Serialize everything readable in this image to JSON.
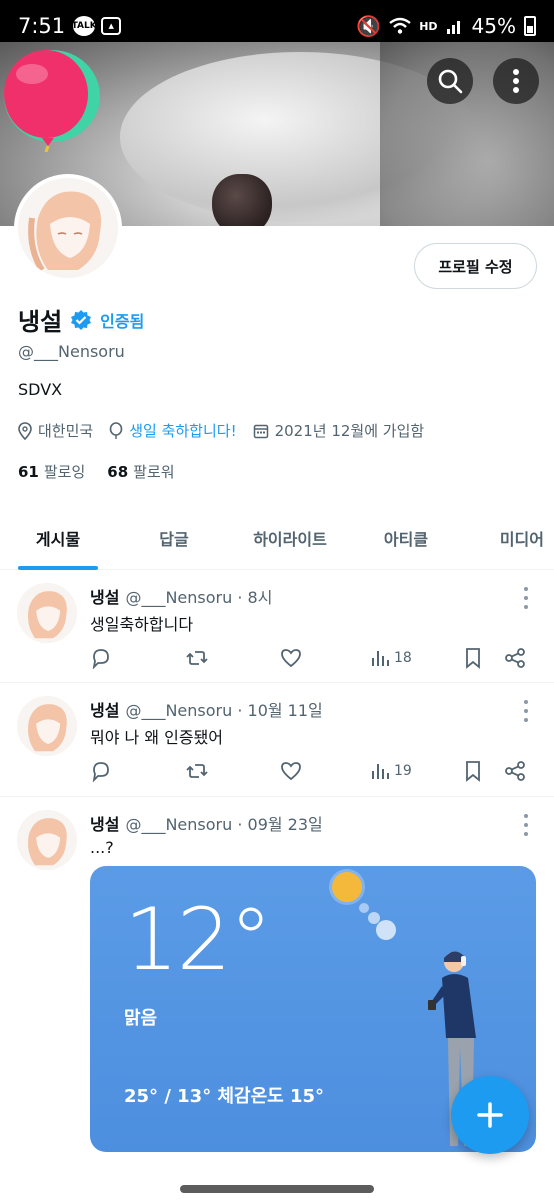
{
  "status_bar": {
    "time": "7:51",
    "talk_label": "TALK",
    "hd_label": "HD",
    "battery": "45%"
  },
  "profile": {
    "display_name": "냉설",
    "verified_label": "인증됨",
    "handle": "@___Nensoru",
    "bio": "SDVX",
    "location": "대한민국",
    "birthday_text": "생일 축하합니다!",
    "joined": "2021년 12월에 가입함",
    "following_count": "61",
    "following_label": "팔로잉",
    "followers_count": "68",
    "followers_label": "팔로워",
    "edit_button": "프로필 수정"
  },
  "tabs": [
    "게시물",
    "답글",
    "하이라이트",
    "아티클",
    "미디어"
  ],
  "posts": [
    {
      "name": "냉설",
      "meta": "@___Nensoru · 8시",
      "text": "생일축하합니다",
      "views": "18"
    },
    {
      "name": "냉설",
      "meta": "@___Nensoru · 10월 11일",
      "text": "뭐야 나 왜 인증됐어",
      "views": "19"
    },
    {
      "name": "냉설",
      "meta": "@___Nensoru · 09월 23일",
      "text": "...?",
      "views": ""
    }
  ],
  "weather_card": {
    "temperature": "12°",
    "condition": "맑음",
    "range_text": "25° / 13° 체감온도 15°"
  },
  "colors": {
    "accent": "#1d9bf0",
    "secondary_text": "#536471",
    "weather_bg": "#4d8fdf"
  }
}
